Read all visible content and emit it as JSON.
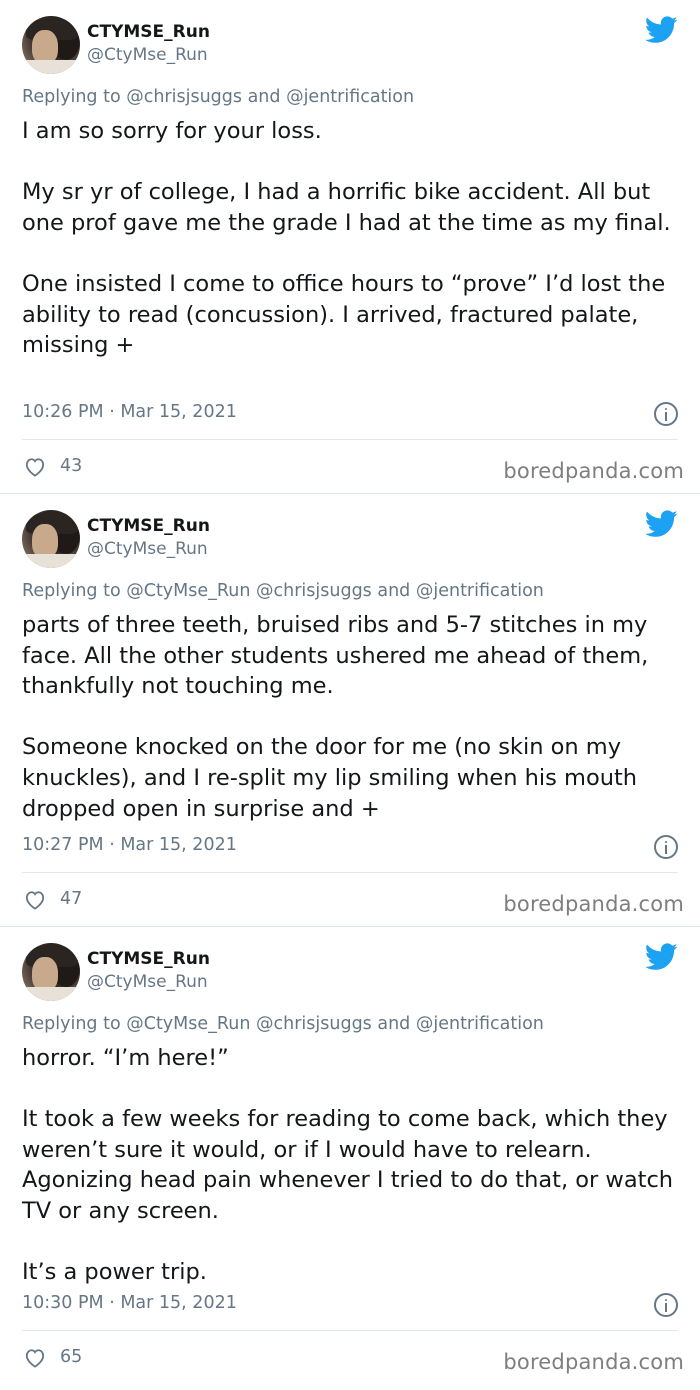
{
  "tweets": [
    {
      "name": "CTYMSE_Run",
      "handle": "@CtyMse_Run",
      "replying_to": "Replying to @chrisjsuggs and @jentrification",
      "text": "I am so sorry for your loss.\n\nMy sr yr of college, I had a horrific bike accident. All but one prof gave me the grade I had at the time as my final.\n\nOne insisted I come to office hours to “prove” I’d lost the ability to read (concussion). I arrived, fractured palate, missing +",
      "timestamp": "10:26 PM · Mar 15, 2021",
      "likes": "43",
      "watermark": "boredpanda.com"
    },
    {
      "name": "CTYMSE_Run",
      "handle": "@CtyMse_Run",
      "replying_to": "Replying to @CtyMse_Run @chrisjsuggs and @jentrification",
      "text": "parts of three teeth, bruised ribs and 5-7 stitches in my face. All the other students ushered me ahead of them, thankfully not touching me.\n\nSomeone knocked on the door for me (no skin on my knuckles), and I re-split my lip smiling when his mouth dropped open in surprise and +",
      "timestamp": "10:27 PM · Mar 15, 2021",
      "likes": "47",
      "watermark": "boredpanda.com"
    },
    {
      "name": "CTYMSE_Run",
      "handle": "@CtyMse_Run",
      "replying_to": "Replying to @CtyMse_Run @chrisjsuggs and @jentrification",
      "text": "horror. “I’m here!”\n\nIt took a few weeks for reading to come back, which they weren’t sure it would, or if I would have to relearn. Agonizing head pain whenever I tried to do that, or watch TV or any screen.\n\nIt’s a power trip.",
      "timestamp": "10:30 PM · Mar 15, 2021",
      "likes": "65",
      "watermark": "boredpanda.com"
    }
  ],
  "icons": {
    "brand": "twitter-bird-icon",
    "info": "info-icon",
    "like": "heart-icon"
  },
  "colors": {
    "brand_blue": "#1da1f2",
    "secondary_text": "#657786",
    "primary_text": "#14171a",
    "divider": "#e1e8ed"
  }
}
